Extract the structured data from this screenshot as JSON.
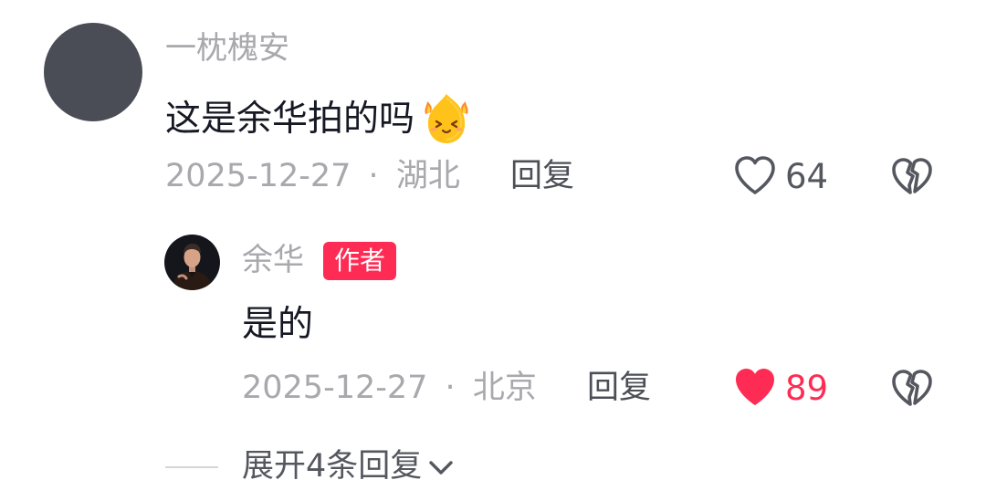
{
  "comments": [
    {
      "username": "一枕槐安",
      "text": "这是余华拍的吗",
      "emoji_icon": "fire-smile-emoji-icon",
      "date": "2025-12-27",
      "separator": "·",
      "location": "湖北",
      "reply_label": "回复",
      "like_count": "64",
      "liked": false,
      "dislike_icon": "broken-heart-icon",
      "avatar_color": "#4a4d55",
      "replies": [
        {
          "username": "余华",
          "badge": "作者",
          "text": "是的",
          "date": "2025-12-27",
          "separator": "·",
          "location": "北京",
          "reply_label": "回复",
          "like_count": "89",
          "liked": true,
          "dislike_icon": "broken-heart-icon"
        }
      ],
      "expand_label": "展开4条回复",
      "expand_icon": "chevron-down-icon"
    }
  ],
  "colors": {
    "accent": "#fe2c55",
    "secondary_text": "#a8a8ad",
    "primary_text": "#161823",
    "icon_gray": "#55575f"
  }
}
